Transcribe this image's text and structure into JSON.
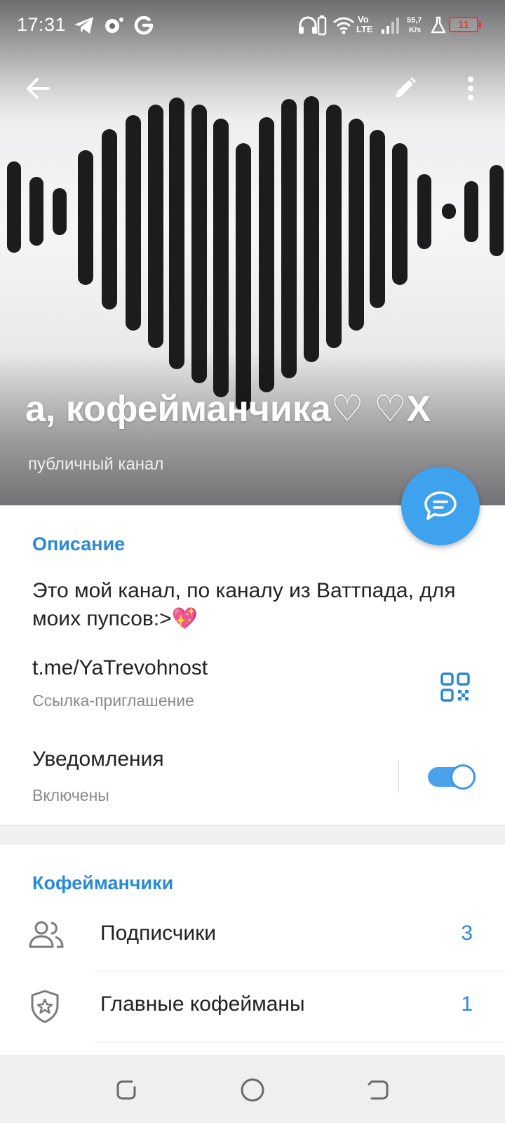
{
  "status_bar": {
    "time": "17:31",
    "network_top": "Vo",
    "network_bottom": "LTE",
    "speed_top": "55,7",
    "speed_bottom": "K/s",
    "battery": "11"
  },
  "header": {
    "channel_title": "а, кофейманчика♡ ♡Х",
    "channel_subtitle": "публичный канал"
  },
  "info": {
    "description_title": "Описание",
    "description_text": "Это мой канал, по каналу из Ваттпада, для моих пупсов:>💖",
    "link": "t.me/YaTrevohnost",
    "link_caption": "Ссылка-приглашение",
    "notifications_label": "Уведомления",
    "notifications_state": "Включены",
    "notifications_on": true
  },
  "members_section": {
    "title": "Кофейманчики",
    "rows": [
      {
        "label": "Подписчики",
        "count": "3",
        "icon": "people-icon"
      },
      {
        "label": "Главные кофейманы",
        "count": "1",
        "icon": "shield-star-icon"
      }
    ]
  },
  "colors": {
    "accent": "#2a8ad6",
    "fab": "#3fa2ee",
    "toggle": "#4aa3ea",
    "battery_low": "#e53935"
  }
}
